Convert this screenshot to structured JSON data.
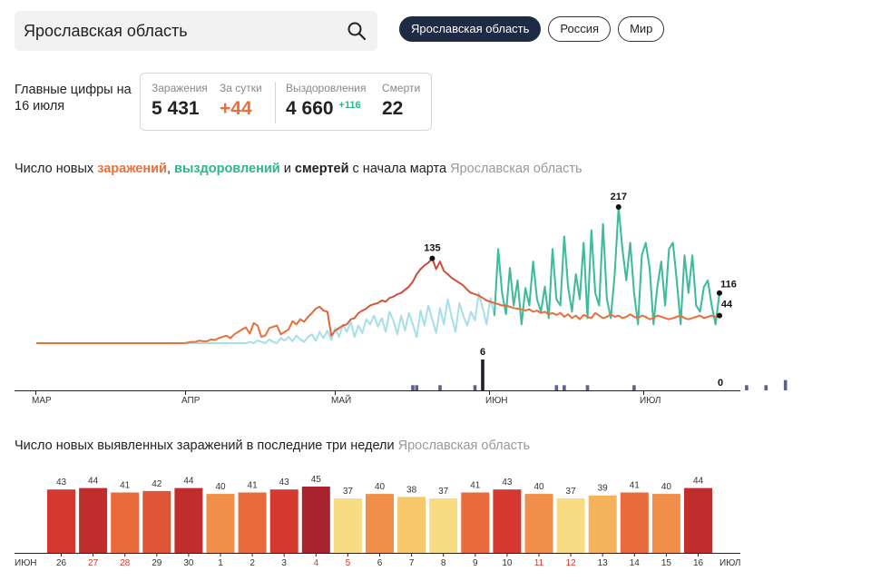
{
  "search": {
    "value": "Ярославская область"
  },
  "regions": [
    "Ярославская область",
    "Россия",
    "Мир"
  ],
  "summary": {
    "title": "Главные цифры на 16 июля",
    "infections_label": "Заражения",
    "infections_value": "5 431",
    "day_label": "За сутки",
    "day_value": "+44",
    "recovered_label": "Выздоровления",
    "recovered_value": "4 660",
    "recovered_delta": "+116",
    "deaths_label": "Смерти",
    "deaths_value": "22"
  },
  "chart1": {
    "title_prefix": "Число новых ",
    "title_infections": "заражений",
    "title_comma": ", ",
    "title_recoveries": "выздоровлений",
    "title_and": " и ",
    "title_deaths": "смертей",
    "title_suffix": " с начала марта",
    "region": "Ярославская область"
  },
  "chart2": {
    "title": "Число новых выявленных заражений в последние три недели",
    "region": "Ярославская область"
  },
  "colors": {
    "infections": "#e9703a",
    "infections_peak": "#c8463a",
    "recoveries": "#2db58e",
    "recoveries_light": "#a6dfe8",
    "deaths": "#5b6189",
    "deaths_peak": "#1c1f33"
  },
  "chart_data": [
    {
      "type": "line",
      "x_ticks": [
        "МАР",
        "АПР",
        "МАЙ",
        "ИЮН",
        "ИЮЛ"
      ],
      "series": [
        {
          "name": "заражений",
          "values": [
            0,
            0,
            0,
            0,
            0,
            0,
            0,
            0,
            0,
            0,
            0,
            0,
            0,
            0,
            0,
            0,
            0,
            0,
            0,
            0,
            0,
            0,
            0,
            0,
            0,
            0,
            0,
            0,
            0,
            0,
            0,
            0,
            0,
            0,
            0,
            0,
            0,
            0,
            0,
            1,
            2,
            2,
            4,
            3,
            3,
            6,
            5,
            8,
            10,
            12,
            8,
            14,
            18,
            22,
            25,
            15,
            32,
            28,
            10,
            12,
            24,
            26,
            28,
            14,
            18,
            22,
            35,
            30,
            38,
            34,
            42,
            48,
            55,
            58,
            52,
            50,
            12,
            20,
            24,
            28,
            30,
            38,
            40,
            48,
            52,
            55,
            60,
            62,
            64,
            68,
            66,
            72,
            74,
            78,
            80,
            85,
            90,
            98,
            110,
            118,
            124,
            128,
            135,
            118,
            130,
            115,
            110,
            104,
            100,
            96,
            92,
            85,
            80,
            78,
            76,
            72,
            68,
            66,
            64,
            62,
            60,
            60,
            58,
            56,
            55,
            54,
            52,
            54,
            50,
            52,
            48,
            50,
            46,
            48,
            45,
            48,
            42,
            46,
            40,
            44,
            38,
            45,
            42,
            40,
            48,
            44,
            40,
            42,
            46,
            42,
            44,
            40,
            42,
            46,
            42,
            40,
            44,
            42,
            38,
            40,
            44,
            42,
            40,
            38,
            40,
            42,
            44,
            40,
            38,
            40,
            42,
            44,
            40,
            42,
            44,
            42,
            44
          ]
        },
        {
          "name": "выздоровлений",
          "values": [
            0,
            0,
            0,
            0,
            0,
            0,
            0,
            0,
            0,
            0,
            0,
            0,
            0,
            0,
            0,
            0,
            0,
            0,
            0,
            0,
            0,
            0,
            0,
            0,
            0,
            0,
            0,
            0,
            0,
            0,
            0,
            0,
            0,
            0,
            0,
            0,
            0,
            0,
            0,
            0,
            0,
            0,
            0,
            0,
            0,
            0,
            0,
            0,
            0,
            0,
            0,
            0,
            0,
            0,
            0,
            2,
            0,
            4,
            2,
            0,
            6,
            2,
            0,
            8,
            4,
            10,
            3,
            12,
            6,
            2,
            10,
            14,
            4,
            18,
            8,
            20,
            5,
            24,
            10,
            30,
            18,
            34,
            10,
            28,
            16,
            38,
            30,
            44,
            26,
            40,
            18,
            50,
            36,
            14,
            44,
            20,
            48,
            30,
            10,
            52,
            28,
            60,
            38,
            16,
            56,
            30,
            70,
            42,
            18,
            64,
            44,
            28,
            50,
            36,
            80,
            56,
            30,
            72,
            44,
            150,
            80,
            46,
            120,
            60,
            100,
            30,
            88,
            60,
            130,
            70,
            50,
            90,
            40,
            150,
            70,
            60,
            170,
            90,
            50,
            110,
            70,
            160,
            40,
            180,
            80,
            60,
            190,
            70,
            40,
            110,
            217,
            150,
            100,
            160,
            80,
            30,
            140,
            160,
            120,
            30,
            90,
            130,
            60,
            150,
            160,
            100,
            30,
            140,
            80,
            140,
            60,
            50,
            90,
            100,
            60,
            30,
            80,
            150,
            100,
            116
          ]
        },
        {
          "name": "смертей",
          "values": [
            0,
            0,
            0,
            0,
            0,
            0,
            0,
            0,
            0,
            0,
            0,
            0,
            0,
            0,
            0,
            0,
            0,
            0,
            0,
            0,
            0,
            0,
            0,
            0,
            0,
            0,
            0,
            0,
            0,
            0,
            0,
            0,
            0,
            0,
            0,
            0,
            0,
            0,
            0,
            0,
            0,
            0,
            0,
            0,
            0,
            0,
            0,
            0,
            0,
            0,
            0,
            0,
            0,
            0,
            0,
            0,
            0,
            0,
            0,
            0,
            0,
            0,
            0,
            0,
            0,
            0,
            0,
            0,
            0,
            0,
            0,
            0,
            0,
            0,
            0,
            0,
            0,
            0,
            0,
            0,
            0,
            0,
            0,
            0,
            0,
            0,
            0,
            0,
            0,
            0,
            0,
            0,
            0,
            0,
            0,
            0,
            0,
            1,
            1,
            0,
            0,
            0,
            0,
            0,
            1,
            0,
            0,
            0,
            0,
            0,
            0,
            0,
            0,
            1,
            0,
            6,
            0,
            0,
            0,
            0,
            0,
            0,
            0,
            0,
            0,
            0,
            0,
            0,
            0,
            0,
            0,
            0,
            0,
            0,
            1,
            0,
            1,
            0,
            0,
            0,
            0,
            0,
            1,
            0,
            0,
            0,
            0,
            0,
            0,
            0,
            0,
            0,
            0,
            0,
            1,
            0,
            0,
            0,
            0,
            0,
            0,
            0,
            0,
            0,
            0,
            0,
            0,
            0,
            0,
            0,
            0,
            0,
            0,
            0,
            0,
            0,
            0,
            0,
            0,
            0,
            0,
            0,
            0,
            1,
            0,
            0,
            0,
            0,
            1,
            0,
            0,
            0,
            0,
            2,
            0,
            0,
            0,
            0,
            0,
            0
          ]
        }
      ],
      "annotations": [
        {
          "series": "заражений",
          "label": "135"
        },
        {
          "series": "выздоровлений",
          "label": "217"
        },
        {
          "series": "смертей",
          "label": "6"
        },
        {
          "series": "выздоровлений",
          "label": "116"
        },
        {
          "series": "заражений",
          "label": "44"
        },
        {
          "series": "смертей",
          "label": "0"
        }
      ]
    },
    {
      "type": "bar",
      "categories": [
        "26",
        "27",
        "28",
        "29",
        "30",
        "1",
        "2",
        "3",
        "4",
        "5",
        "6",
        "7",
        "8",
        "9",
        "10",
        "11",
        "12",
        "13",
        "14",
        "15",
        "16"
      ],
      "weekend": [
        false,
        true,
        true,
        false,
        false,
        false,
        false,
        false,
        true,
        true,
        false,
        false,
        false,
        false,
        false,
        true,
        true,
        false,
        false,
        false,
        false
      ],
      "values": [
        43,
        44,
        41,
        42,
        44,
        40,
        41,
        43,
        45,
        37,
        40,
        38,
        37,
        41,
        43,
        40,
        37,
        39,
        41,
        40,
        44
      ],
      "month_left": "ИЮН",
      "month_right": "ИЮЛ",
      "ylim": [
        0,
        45
      ]
    }
  ]
}
